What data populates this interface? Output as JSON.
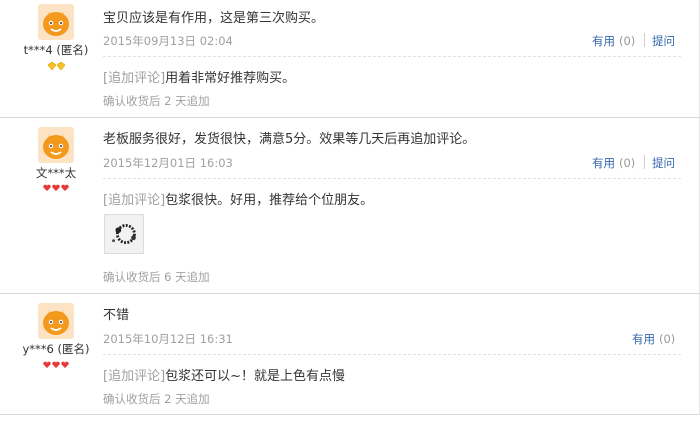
{
  "reviews": [
    {
      "user": "t***4 (匿名)",
      "text": "宝贝应该是有作用，这是第三次购买。",
      "date": "2015年09月13日 02:04",
      "useful_label": "有用",
      "useful_count": "(0)",
      "ask_label": "提问",
      "append_tag": "[追加评论]",
      "append_text": "用着非常好推荐购买。",
      "confirm": "确认收货后 2 天追加",
      "badge": "gold-diamonds",
      "badge_count": 2
    },
    {
      "user": "文***太",
      "text": "老板服务很好，发货很快，满意5分。效果等几天后再追加评论。",
      "date": "2015年12月01日 16:03",
      "useful_label": "有用",
      "useful_count": "(0)",
      "ask_label": "提问",
      "append_tag": "[追加评论]",
      "append_text": "包浆很快。好用，推荐给个位朋友。",
      "confirm": "确认收货后 6 天追加",
      "badge": "red-hearts",
      "badge_count": 3
    },
    {
      "user": "y***6 (匿名)",
      "text": "不错",
      "date": "2015年10月12日 16:31",
      "useful_label": "有用",
      "useful_count": "(0)",
      "append_tag": "[追加评论]",
      "append_text": "包浆还可以~！就是上色有点慢",
      "confirm": "确认收货后 2 天追加",
      "badge": "red-hearts",
      "badge_count": 3
    }
  ],
  "colors": {
    "link": "#3366aa",
    "muted": "#a0a0a0",
    "text": "#333333",
    "avatar": "#f39a1e",
    "gold_badge": "#f7c325",
    "red_badge": "#e53b3b"
  },
  "icons": {
    "avatar": "orange-mascot-avatar-icon",
    "photo": "review-photo-thumbnail"
  }
}
